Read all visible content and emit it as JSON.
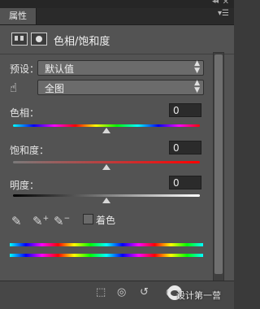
{
  "window": {
    "collapse_icon": "double-chevron",
    "close_icon": "close"
  },
  "tab": {
    "label": "属性",
    "menu_icon": "panel-menu"
  },
  "header": {
    "title": "色相/饱和度"
  },
  "preset": {
    "label": "预设：",
    "value": "默认值"
  },
  "channel": {
    "value": "全图"
  },
  "sliders": [
    {
      "label": "色相：",
      "value": "0",
      "position": 0.5
    },
    {
      "label": "饱和度：",
      "value": "0",
      "position": 0.5
    },
    {
      "label": "明度：",
      "value": "0",
      "position": 0.5
    }
  ],
  "colorize": {
    "label": "着色",
    "checked": false
  },
  "footer": {
    "watermark": "设计第一营"
  }
}
